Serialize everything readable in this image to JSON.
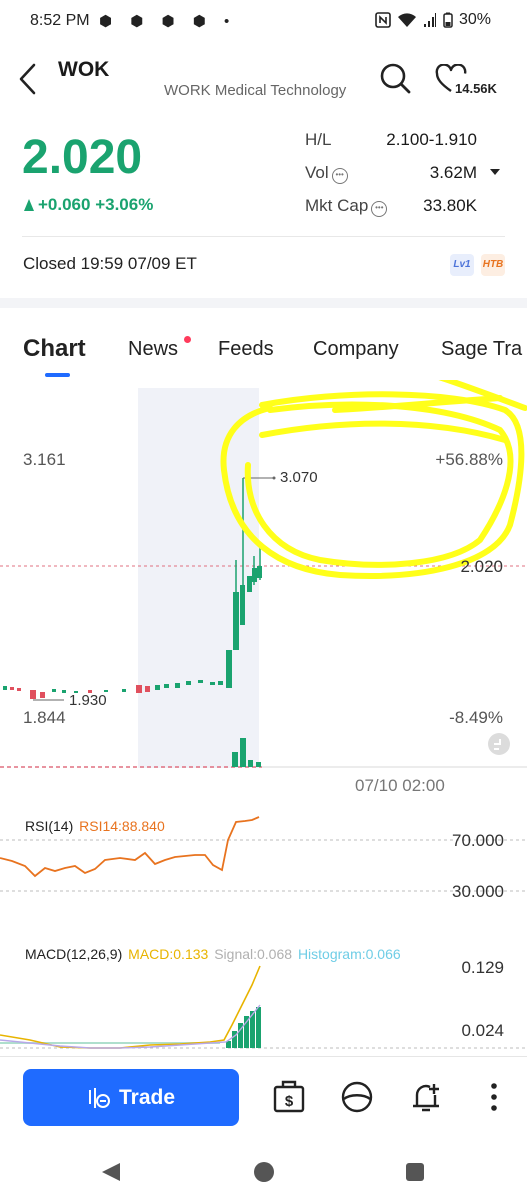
{
  "status_bar": {
    "time": "8:52 PM",
    "notif_icons": "⬢ ⬢ ⬢ ⬢ •",
    "battery": "30%"
  },
  "header": {
    "ticker": "WOK",
    "company_name": "WORK Medical Technology",
    "favorites_count": "14.56K"
  },
  "quote": {
    "price": "2.020",
    "change": "+0.060 +3.06%",
    "stats": [
      {
        "label": "H/L",
        "value": "2.100-1.910"
      },
      {
        "label": "Vol",
        "value": "3.62M"
      },
      {
        "label": "Mkt Cap",
        "value": "33.80K"
      }
    ],
    "status": "Closed 19:59 07/09 ET",
    "badges": [
      "Lv1",
      "HTB"
    ]
  },
  "tabs": [
    "Chart",
    "News",
    "Feeds",
    "Company",
    "Sage Tra"
  ],
  "chart": {
    "y_high": "3.161",
    "y_low": "1.844",
    "pct_high": "+56.88%",
    "pct_low": "-8.49%",
    "peak_label": "3.070",
    "low_label": "1.930",
    "current_label": "2.020",
    "date_label": "07/10  02:00"
  },
  "rsi": {
    "title": "RSI(14)",
    "value": "RSI14:88.840",
    "level_high": "70.000",
    "level_low": "30.000"
  },
  "macd": {
    "title": "MACD(12,26,9)",
    "macd": "MACD:0.133",
    "signal": "Signal:0.068",
    "histogram": "Histogram:0.066",
    "axis_high": "0.129",
    "axis_low": "0.024"
  },
  "bottom": {
    "trade_label": "Trade"
  },
  "colors": {
    "up": "#1aa36f",
    "down": "#e0505e",
    "accent": "#1f6bff",
    "rsi": "#e8731f",
    "macd": "#e8b400",
    "hist": "#7fd3e8",
    "highlight": "#ffff1a"
  }
}
